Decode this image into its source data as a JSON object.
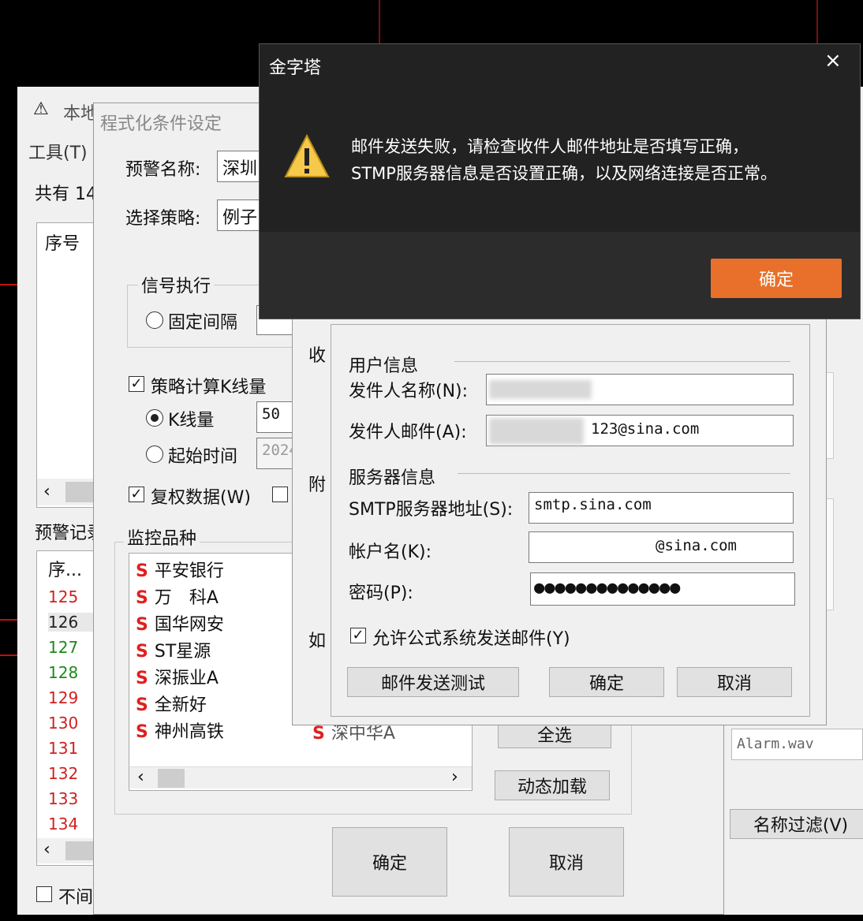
{
  "back_window": {
    "title": "本地",
    "menu_tools": "工具(T)",
    "total_label": "共有 14",
    "col_index": "序号",
    "alert_records_label": "预警记录",
    "col_index2": "序...",
    "row_numbers": [
      "125",
      "126",
      "127",
      "128",
      "129",
      "130",
      "131",
      "132",
      "133",
      "134"
    ],
    "no_interval_label": "不间"
  },
  "settings_window": {
    "title": "程式化条件设定",
    "alert_name_label": "预警名称:",
    "alert_name_value": "深圳",
    "strategy_label": "选择策略:",
    "strategy_value": "例子",
    "signal_group": "信号执行",
    "fixed_interval_label": "固定间隔",
    "calc_kline_label": "策略计算K线量",
    "kline_label": "K线量",
    "kline_value": "50",
    "start_time_label": "起始时间",
    "start_time_value": "2024",
    "adjust_data_label": "复权数据(W)",
    "monitor_label": "监控品种",
    "stocks": [
      "平安银行",
      "万　科A",
      "国华网安",
      "ST星源",
      "深振业A",
      "全新好",
      "神州高铁"
    ],
    "stock_partial": "深中华A",
    "select_all": "全选",
    "dynamic_load": "动态加载",
    "ok": "确定",
    "cancel": "取消"
  },
  "right_panel": {
    "sound_file": "Alarm.wav",
    "name_filter": "名称过滤(V)"
  },
  "mail_dialog": {
    "side_labels": [
      "收",
      "附",
      "如"
    ],
    "user_info": "用户信息",
    "sender_name_label": "发件人名称(N):",
    "sender_email_label": "发件人邮件(A):",
    "sender_email_value": "123@sina.com",
    "server_info": "服务器信息",
    "smtp_label": "SMTP服务器地址(S):",
    "smtp_value": "smtp.sina.com",
    "account_label": "帐户名(K):",
    "account_value": "@sina.com",
    "password_label": "密码(P):",
    "password_value": "●●●●●●●●●●●●●●",
    "allow_send_label": "允许公式系统发送邮件(Y)",
    "test_button": "邮件发送测试",
    "ok": "确定",
    "cancel": "取消"
  },
  "error_dialog": {
    "title": "金字塔",
    "close": "×",
    "message_line1": "邮件发送失败，请检查收件人邮件地址是否填写正确，",
    "message_line2": "STMP服务器信息是否设置正确，以及网络连接是否正常。",
    "ok": "确定",
    "accent": "#e8702a"
  }
}
